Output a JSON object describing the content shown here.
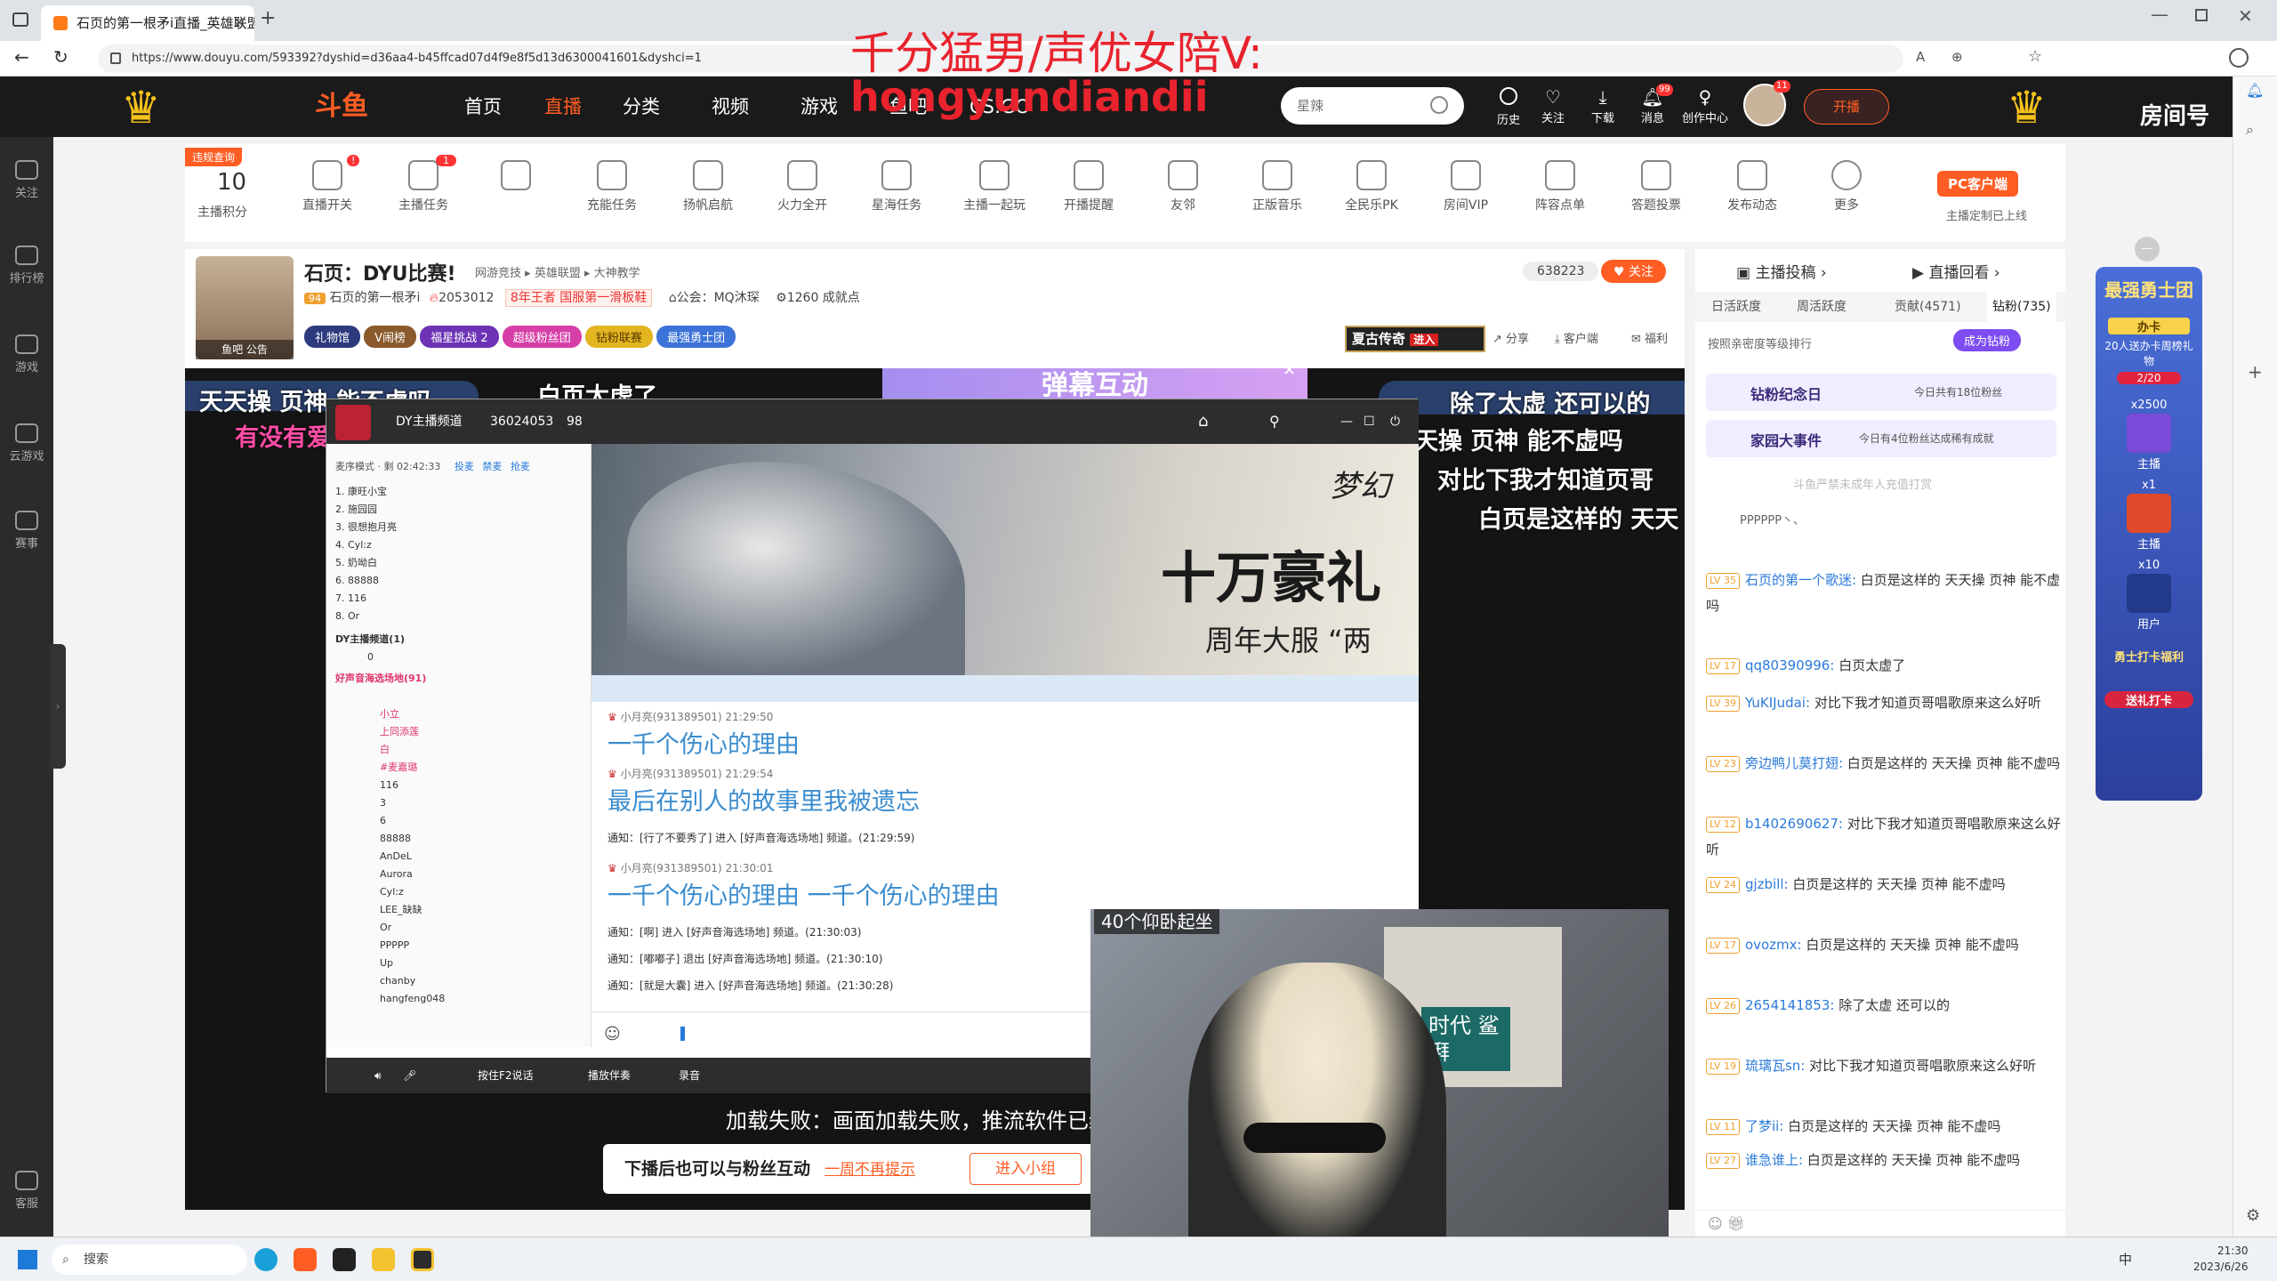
{
  "browser": {
    "tab_title": "石页的第一根矛i直播_英雄联盟直",
    "url": "https://www.douyu.com/593392?dyshid=d36aa4-b45ffcad07d4f9e8f5d13d6300041601&dyshci=1"
  },
  "header": {
    "logo": "斗鱼",
    "nav": [
      "首页",
      "直播",
      "分类",
      "视频",
      "游戏",
      "鱼吧",
      "CS:GO"
    ],
    "search_placeholder": "星辣",
    "actions": [
      "历史",
      "关注",
      "下载",
      "消息",
      "创作中心"
    ],
    "message_badge": "99",
    "avatar_badge": "11",
    "broadcast_button": "开播",
    "room_label": "房间号",
    "overlay_text": "千分猛男/声优女陪V:",
    "overlay_id": "hongyundiandii"
  },
  "left_nav": [
    "关注",
    "排行榜",
    "游戏",
    "云游戏",
    "赛事",
    "客服"
  ],
  "toolbar": {
    "violation_tag": "违规查询",
    "score": "10",
    "score_label": "主播积分",
    "items": [
      "直播开关",
      "主播任务",
      "",
      "充能任务",
      "扬帆启航",
      "火力全开",
      "星海任务",
      "主播一起玩",
      "开播提醒",
      "友邻",
      "正版音乐",
      "全民乐PK",
      "房间VIP",
      "阵容点单",
      "答题投票",
      "发布动态",
      "更多"
    ],
    "badges": [
      "!",
      "1"
    ],
    "pc_client_button": "PC客户端",
    "pc_client_sub": "主播定制已上线"
  },
  "streamer": {
    "title": "石页：DYU比赛!",
    "breadcrumb": [
      "网游竞技",
      "英雄联盟",
      "大神教学"
    ],
    "level": "94",
    "name": "石页的第一根矛i",
    "hot": "2053012",
    "rank_tag": "8年王者 国服第一滑板鞋",
    "guild": "公会：MQ沐琛",
    "fans": "1260 成就点",
    "follow_count": "638223",
    "follow_button": "关注",
    "avatar_caption": [
      "鱼吧",
      "公告"
    ],
    "tags": [
      "礼物馆",
      "V闹榜",
      "福星挑战 2",
      "超级粉丝团",
      "钻粉联赛",
      "最强勇士团"
    ],
    "game_banner": "夏古传奇",
    "game_enter": "进入",
    "links": [
      "分享",
      "客户端",
      "福利"
    ]
  },
  "player": {
    "danmu_left_1": "天天操 页神 能不虚吗",
    "danmu_left_2": "有没有爱",
    "danmu_top": "白页太虚了",
    "barrage_panel": "弹幕互动",
    "danmu_right_1": "除了太虚 还可以的",
    "danmu_right_2": "天操 页神 能不虚吗",
    "danmu_right_3": "对比下我才知道页哥",
    "danmu_right_4": "白页是这样的 天天",
    "load_fail": "加载失败：画面加载失败，推流软件已经",
    "notice_text": "下播后也可以与粉丝互动",
    "notice_link": "一周不再提示",
    "notice_button": "进入小组",
    "cam_caption": "40个仰卧起坐",
    "cam_sign": "时代 鲨湃"
  },
  "voice_app": {
    "channel": "DY主播频道",
    "channel_id": "36024053",
    "members": "98",
    "mode": "麦序模式 · 剩 02:42:33",
    "mode_actions": [
      "投麦",
      "禁麦",
      "抢麦"
    ],
    "queue": [
      "康旺小宝",
      "施园园",
      "很想抱月亮",
      "Cyl:z",
      "奶呦白",
      "88888",
      "116",
      "Or"
    ],
    "group1": "DY主播频道(1)",
    "group1_user": "0",
    "group2": "好声音海选场地(91)",
    "group2_users": [
      "",
      "小立",
      "上同添莲",
      "白",
      "#麦嘉璐",
      "116",
      "3",
      "6",
      "88888",
      "AnDeL",
      "Aurora",
      "Cyl:z",
      "LEE_缺缺",
      "Or",
      "PPPPP",
      "Up",
      "chanby",
      "hangfeng048"
    ],
    "banner_title": "十万豪礼",
    "banner_sub": "周年大服 “两",
    "banner_game": "梦幻",
    "messages": [
      {
        "user": "小月亮(931389501)",
        "time": "21:29:50",
        "text": "一千个伤心的理由"
      },
      {
        "user": "小月亮(931389501)",
        "time": "21:29:54",
        "text": "最后在别人的故事里我被遗忘"
      },
      {
        "notice": "通知：[行了不要秀了] 进入 [好声音海选场地] 频道。(21:29:59)"
      },
      {
        "user": "小月亮(931389501)",
        "time": "21:30:01",
        "text": "一千个伤心的理由 一千个伤心的理由"
      },
      {
        "notice": "通知：[啊] 进入 [好声音海选场地] 频道。(21:30:03)"
      },
      {
        "notice": "通知：[嘟嘟子] 退出 [好声音海选场地] 频道。(21:30:10)"
      },
      {
        "notice": "通知：[就是大囊] 进入 [好声音海选场地] 频道。(21:30:28)"
      }
    ],
    "bottom": [
      "按住F2说话",
      "播放伴奏",
      "录音"
    ]
  },
  "chat": {
    "tabs": [
      "主播投稿",
      "直播回看"
    ],
    "rank_tabs": [
      "日活跃度",
      "周活跃度",
      "贡献(4571)",
      "钻粉(735)"
    ],
    "rank_hint": "按照亲密度等级排行",
    "become_fan": "成为钻粉",
    "event1": "钻粉纪念日",
    "event1_sub": "今日共有18位粉丝",
    "event2": "家园大事件",
    "event2_sub": "今日有4位粉丝达成稀有成就",
    "watermark": "斗鱼严禁未成年人充值打赏",
    "top_user": "PPPPPP丶、",
    "messages": [
      {
        "lv": "LV 35",
        "user": "石页的第一个歌迷:",
        "text": "白页是这样的 天天操 页神 能不虚吗"
      },
      {
        "lv": "LV 17",
        "user": "qq80390996:",
        "text": "白页太虚了"
      },
      {
        "lv": "LV 39",
        "user": "YuKIJudai:",
        "text": "对比下我才知道页哥唱歌原来这么好听"
      },
      {
        "lv": "LV 23",
        "user": "旁边鸭儿莫打翅:",
        "text": "白页是这样的 天天操 页神 能不虚吗"
      },
      {
        "lv": "LV 12",
        "user": "b1402690627:",
        "text": "对比下我才知道页哥唱歌原来这么好听"
      },
      {
        "lv": "LV 24",
        "user": "gjzbill:",
        "text": "白页是这样的 天天操 页神 能不虚吗"
      },
      {
        "lv": "LV 17",
        "user": "ovozmx:",
        "text": "白页是这样的 天天操 页神 能不虚吗"
      },
      {
        "lv": "LV 26",
        "user": "2654141853:",
        "text": "除了太虚 还可以的"
      },
      {
        "lv": "LV 19",
        "user": "琉璃瓦sn:",
        "text": "对比下我才知道页哥唱歌原来这么好听"
      },
      {
        "lv": "LV 11",
        "user": "了梦ii:",
        "text": "白页是这样的 天天操 页神 能不虚吗"
      },
      {
        "lv": "LV 27",
        "user": "谁急谁上:",
        "text": "白页是这样的 天天操 页神 能不虚吗"
      }
    ]
  },
  "promo": {
    "title": "最强勇士团",
    "card": "办卡",
    "card_sub": "20人送办卡周榜礼物",
    "progress": "2/20",
    "rewards": [
      {
        "count": "x2500",
        "label": "主播"
      },
      {
        "count": "x1",
        "label": "主播"
      },
      {
        "count": "x10",
        "label": "用户"
      }
    ],
    "checkin": "勇士打卡福利",
    "checkin_btn": "送礼打卡"
  },
  "taskbar": {
    "search": "搜索",
    "time": "21:30",
    "date": "2023/6/26",
    "ime": "中"
  },
  "colors": {
    "brand": "#ff5d23",
    "header": "#1a1a1a",
    "link": "#2a7ad9",
    "level": "#f0a030",
    "red_overlay": "#e8232d"
  }
}
